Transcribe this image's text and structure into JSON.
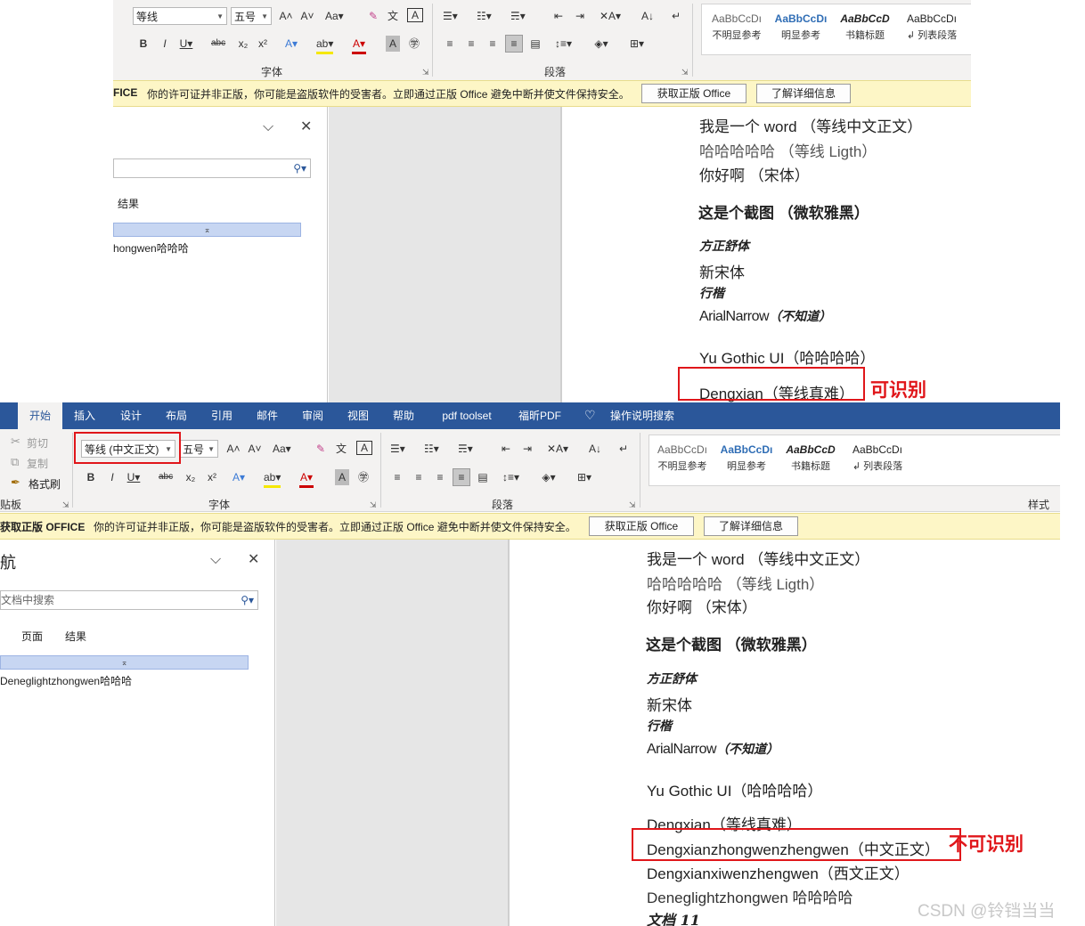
{
  "top": {
    "font_name": "等线",
    "font_size": "五号",
    "font_group_label": "字体",
    "paragraph_group_label": "段落",
    "styles": [
      {
        "preview": "AaBbCcDı",
        "label": "不明显参考"
      },
      {
        "preview": "AaBbCcDı",
        "label": "明显参考"
      },
      {
        "preview": "AaBbCcD",
        "label": "书籍标题"
      },
      {
        "preview": "AaBbCcDı",
        "label": "列表段落"
      }
    ],
    "warning": {
      "title": "FICE",
      "message": "你的许可证并非正版，你可能是盗版软件的受害者。立即通过正版 Office 避免中断并使文件保持安全。",
      "button1": "获取正版 Office",
      "button2": "了解详细信息"
    },
    "nav": {
      "results_tab": "结果",
      "heading": "hongwen哈哈哈"
    },
    "doc_lines": [
      "我是一个 word （等线中文正文）",
      "哈哈哈哈哈 （等线 Ligth）",
      "你好啊 （宋体）",
      "这是个截图 （微软雅黑）",
      "方正舒体",
      "新宋体",
      "行楷",
      "ArialNarrow",
      "（不知道）",
      "Yu Gothic UI（哈哈哈哈）",
      "Dengxian（等线真难）"
    ],
    "annotation": "可识别"
  },
  "bottom": {
    "tabs": [
      "开始",
      "插入",
      "设计",
      "布局",
      "引用",
      "邮件",
      "审阅",
      "视图",
      "帮助",
      "pdf toolset",
      "福昕PDF",
      "操作说明搜索"
    ],
    "clipboard": {
      "cut": "剪切",
      "copy": "复制",
      "format_painter": "格式刷",
      "label": "剪贴板"
    },
    "font_name": "等线 (中文正文)",
    "font_size": "五号",
    "font_group_label": "字体",
    "paragraph_group_label": "段落",
    "styles_group_label": "样式",
    "styles": [
      {
        "preview": "AaBbCcDı",
        "label": "不明显参考"
      },
      {
        "preview": "AaBbCcDı",
        "label": "明显参考"
      },
      {
        "preview": "AaBbCcD",
        "label": "书籍标题"
      },
      {
        "preview": "AaBbCcDı",
        "label": "列表段落"
      }
    ],
    "warning": {
      "title": "获取正版 OFFICE",
      "message": "你的许可证并非正版，你可能是盗版软件的受害者。立即通过正版 Office 避免中断并使文件保持安全。",
      "button1": "获取正版 Office",
      "button2": "了解详细信息"
    },
    "nav": {
      "title": "航",
      "search_placeholder": "文档中搜索",
      "pages_tab": "页面",
      "results_tab": "结果",
      "heading": "Deneglightzhongwen哈哈哈"
    },
    "doc_lines": [
      "我是一个 word （等线中文正文）",
      "哈哈哈哈哈 （等线 Ligth）",
      "你好啊 （宋体）",
      "这是个截图 （微软雅黑）",
      "方正舒体",
      "新宋体",
      "行楷",
      "ArialNarrow",
      "（不知道）",
      "Yu Gothic UI（哈哈哈哈）",
      "Dengxian（等线真难）",
      "Dengxianzhongwenzhengwen（中文正文）",
      "Dengxianxiwenzhengwen（西文正文）",
      "Deneglightzhongwen 哈哈哈哈",
      "文档 11"
    ],
    "annotation": "不可识别"
  },
  "watermark": "CSDN @铃铛当当",
  "colors": {
    "accent": "#2b579a",
    "annotation": "#e0161a",
    "warning_bg": "#fdf6c6"
  }
}
